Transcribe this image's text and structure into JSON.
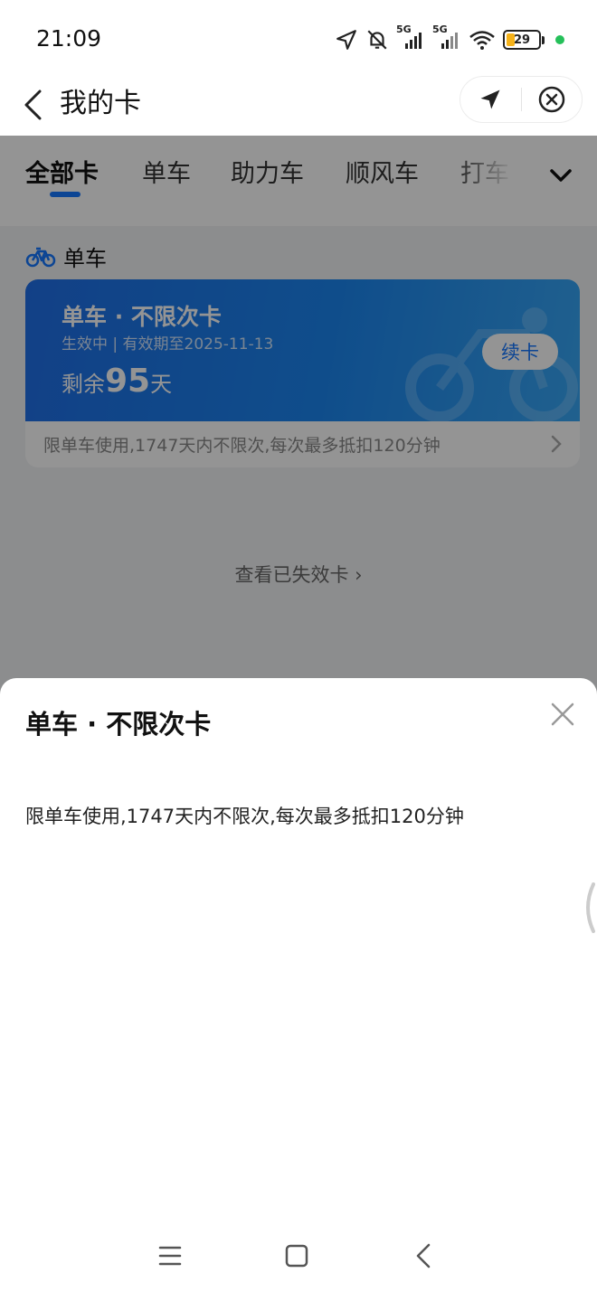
{
  "status_bar": {
    "time": "21:09",
    "signal_1_label": "5G",
    "signal_2_label": "5G",
    "battery_level": "29",
    "icons": [
      "location-arrow-icon",
      "bell-muted-icon",
      "signal-5g-icon",
      "signal-5g-icon",
      "wifi-icon",
      "battery-icon"
    ]
  },
  "header": {
    "title": "我的卡",
    "back_icon": "chevron-left-icon",
    "capsule_icons": [
      "navigate-arrow-icon",
      "close-circle-icon"
    ]
  },
  "tabs": {
    "items": [
      {
        "label": "全部卡",
        "active": true
      },
      {
        "label": "单车",
        "active": false
      },
      {
        "label": "助力车",
        "active": false
      },
      {
        "label": "顺风车",
        "active": false
      },
      {
        "label": "打车",
        "active": false
      }
    ],
    "more_icon": "chevron-down-icon",
    "accent": "#1677ff"
  },
  "section": {
    "title": "单车",
    "icon": "bicycle-icon"
  },
  "card": {
    "name": "单车 · 不限次卡",
    "status": "生效中 | 有效期至2025-11-13",
    "remaining_prefix": "剩余",
    "remaining_days": "95",
    "remaining_suffix": "天",
    "renew_label": "续卡",
    "footer_text": "限单车使用,1747天内不限次,每次最多抵扣120分钟",
    "gradient_colors": [
      "#1f6fe8",
      "#38a7f5"
    ]
  },
  "expired_link": "查看已失效卡 ›",
  "sheet": {
    "title": "单车 · 不限次卡",
    "description": "限单车使用,1747天内不限次,每次最多抵扣120分钟",
    "close_icon": "close-icon"
  },
  "nav_bar": {
    "icons": [
      "menu-icon",
      "home-square-icon",
      "back-chevron-icon"
    ]
  }
}
